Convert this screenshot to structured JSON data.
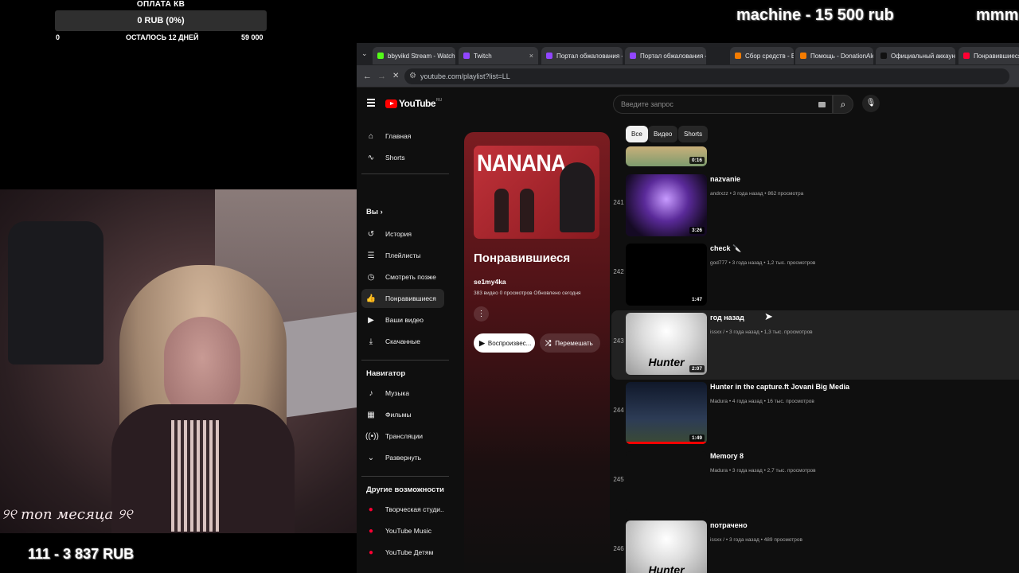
{
  "overlay": {
    "goal": {
      "title": "ОПЛАТА КВ",
      "bar_text": "0 RUB (0%)",
      "progress": 0,
      "min": "0",
      "remaining": "ОСТАЛОСЬ 12 ДНЕЙ",
      "max": "59 000"
    },
    "ticker_1": "machine - 15 500 rub",
    "ticker_2": "mmm",
    "webcam_caption": "୨୧ топ месяца ୨୧",
    "sub_count": "111 - 3 837 RUB"
  },
  "browser": {
    "tabs": [
      {
        "label": "bbyvikd Stream - Watch L",
        "color": "#53fc18",
        "close": "×"
      },
      {
        "label": "Twitch",
        "color": "#9146ff",
        "close": "×"
      },
      {
        "label": "Портал обжалования - ",
        "color": "#9146ff",
        "close": "×"
      },
      {
        "label": "Портал обжалования - ",
        "color": "#9146ff",
        "close": "×"
      },
      {
        "label": "Сбор средств - Виджеты",
        "color": "#f57c00",
        "close": "×"
      },
      {
        "label": "Помощь - DonationAlerts",
        "color": "#f57c00",
        "close": "×"
      },
      {
        "label": "Официальный аккаунт ",
        "color": "#111111",
        "close": "×"
      },
      {
        "label": "Понравившиеся - Y",
        "color": "#ff0033",
        "close": ""
      }
    ],
    "url": "youtube.com/playlist?list=LL",
    "back": "←",
    "forward": "→",
    "stop": "✕"
  },
  "youtube": {
    "logo": "YouTube",
    "logo_region": "RU",
    "search_placeholder": "Введите запрос",
    "sidebar": {
      "main": [
        {
          "icon": "⌂",
          "label": "Главная"
        },
        {
          "icon": "∿",
          "label": "Shorts"
        }
      ],
      "you_header": "Вы  ›",
      "you": [
        {
          "icon": "↺",
          "label": "История"
        },
        {
          "icon": "☰",
          "label": "Плейлисты"
        },
        {
          "icon": "◷",
          "label": "Смотреть позже"
        },
        {
          "icon": "👍",
          "label": "Понравившиеся"
        },
        {
          "icon": "▶",
          "label": "Ваши видео"
        },
        {
          "icon": "⤓",
          "label": "Скачанные"
        }
      ],
      "nav_header": "Навигатор",
      "nav": [
        {
          "icon": "♪",
          "label": "Музыка"
        },
        {
          "icon": "▦",
          "label": "Фильмы"
        },
        {
          "icon": "((•))",
          "label": "Трансляции"
        },
        {
          "icon": "⌄",
          "label": "Развернуть"
        }
      ],
      "more_header": "Другие возможности",
      "more": [
        {
          "icon": "●",
          "label": "Творческая студи..."
        },
        {
          "icon": "●",
          "label": "YouTube Music"
        },
        {
          "icon": "●",
          "label": "YouTube Детям"
        }
      ]
    },
    "playlist": {
      "thumb_text": "NANANA",
      "title": "Понравившиеся",
      "owner": "se1my4ka",
      "meta": "383 видео  0 просмотров  Обновлено сегодня",
      "more": "⋮",
      "play_label": "Воспроизвес...",
      "shuffle_label": "Перемешать"
    },
    "chips": [
      "Все",
      "Видео",
      "Shorts"
    ],
    "videos": [
      {
        "num": "",
        "title": "",
        "meta": "",
        "duration": "0:16"
      },
      {
        "num": "241",
        "title": "nazvanie",
        "meta": "andrxzz • 3 года назад • 862 просмотра",
        "duration": "3:26"
      },
      {
        "num": "242",
        "title": "check 🔪",
        "meta": "god777 • 3 года назад • 1,2 тыс. просмотров",
        "duration": "1:47"
      },
      {
        "num": "243",
        "title": "год назад",
        "meta": "issxx / • 3 года назад • 1,3 тыс. просмотров",
        "duration": "2:07",
        "thumb_text": "Hunter"
      },
      {
        "num": "244",
        "title": "Hunter in the capture.ft Jovani Big Media",
        "meta": "Madura • 4 года назад • 16 тыс. просмотров",
        "duration": "1:49"
      },
      {
        "num": "245",
        "title": "Memory 8",
        "meta": "Madura • 3 года назад • 2,7 тыс. просмотров",
        "duration": ""
      },
      {
        "num": "246",
        "title": "потрачено",
        "meta": "issxx / • 3 года назад • 489 просмотров",
        "duration": "",
        "thumb_text": "Hunter"
      }
    ]
  }
}
